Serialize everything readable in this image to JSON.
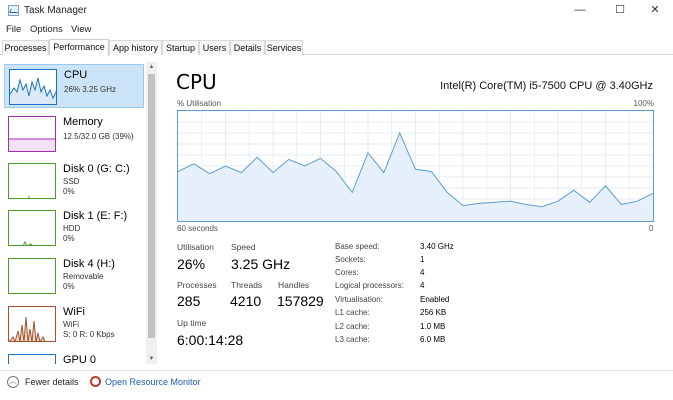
{
  "window": {
    "title": "Task Manager",
    "minimize": "—",
    "maximize": "☐",
    "close": "✕"
  },
  "menu": [
    "File",
    "Options",
    "View"
  ],
  "tabs": [
    "Processes",
    "Performance",
    "App history",
    "Startup",
    "Users",
    "Details",
    "Services"
  ],
  "active_tab": "Performance",
  "sidebar": [
    {
      "name": "CPU",
      "line1": "26% 3.25 GHz",
      "line2": "",
      "color": "#1a73c7"
    },
    {
      "name": "Memory",
      "line1": "12.5/32.0 GB (39%)",
      "line2": "",
      "color": "#9b30a8"
    },
    {
      "name": "Disk 0 (G: C:)",
      "line1": "SSD",
      "line2": "0%",
      "color": "#4aa02c"
    },
    {
      "name": "Disk 1 (E: F:)",
      "line1": "HDD",
      "line2": "0%",
      "color": "#4aa02c"
    },
    {
      "name": "Disk 4 (H:)",
      "line1": "Removable",
      "line2": "0%",
      "color": "#4aa02c"
    },
    {
      "name": "WiFi",
      "line1": "WiFi",
      "line2": "S: 0 R: 0 Kbps",
      "color": "#a0522d"
    },
    {
      "name": "GPU 0",
      "line1": "",
      "line2": "",
      "color": "#1a73c7"
    }
  ],
  "main": {
    "title": "CPU",
    "model": "Intel(R) Core(TM) i5-7500 CPU @ 3.40GHz",
    "graph_ylabel": "% Utilisation",
    "graph_ymax": "100%",
    "graph_xleft": "60 seconds",
    "graph_xright": "0"
  },
  "stats": {
    "utilisation_label": "Utilisation",
    "utilisation": "26%",
    "speed_label": "Speed",
    "speed": "3.25 GHz",
    "processes_label": "Processes",
    "processes": "285",
    "threads_label": "Threads",
    "threads": "4210",
    "handles_label": "Handles",
    "handles": "157829",
    "uptime_label": "Up time",
    "uptime": "6:00:14:28"
  },
  "info": [
    {
      "label": "Base speed:",
      "value": "3.40 GHz"
    },
    {
      "label": "Sockets:",
      "value": "1"
    },
    {
      "label": "Cores:",
      "value": "4"
    },
    {
      "label": "Logical processors:",
      "value": "4"
    },
    {
      "label": "Virtualisation:",
      "value": "Enabled"
    },
    {
      "label": "L1 cache:",
      "value": "256 KB"
    },
    {
      "label": "L2 cache:",
      "value": "1.0 MB"
    },
    {
      "label": "L3 cache:",
      "value": "6.0 MB"
    }
  ],
  "footer": {
    "fewer_details": "Fewer details",
    "open_monitor": "Open Resource Monitor"
  },
  "chart_data": {
    "type": "area",
    "ylabel": "% Utilisation",
    "ylim": [
      0,
      100
    ],
    "xlim": [
      60,
      0
    ],
    "x": [
      60,
      58,
      56,
      54,
      52,
      50,
      48,
      46,
      44,
      42,
      40,
      38,
      36,
      34,
      32,
      30,
      28,
      26,
      24,
      22,
      20,
      18,
      16,
      14,
      12,
      10,
      8,
      6,
      4,
      2,
      0
    ],
    "series": [
      {
        "values": [
          45,
          52,
          43,
          50,
          44,
          58,
          44,
          56,
          50,
          57,
          45,
          26,
          62,
          44,
          80,
          47,
          45,
          26,
          14,
          16,
          17,
          18,
          15,
          13,
          18,
          28,
          17,
          32,
          15,
          18,
          25
        ]
      }
    ],
    "grid": true,
    "color": "#5b9bd5"
  }
}
